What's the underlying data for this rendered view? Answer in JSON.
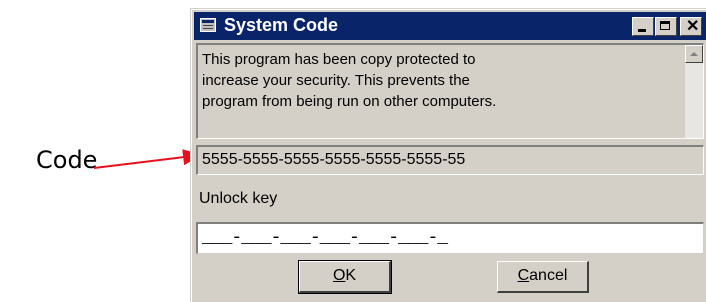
{
  "annotation": {
    "label": "Code",
    "arrow_color": "#e8101a"
  },
  "window": {
    "title": "System Code",
    "icon": "window-app-icon",
    "controls": {
      "minimize_icon": "minimize-icon",
      "maximize_icon": "maximize-icon",
      "close_glyph": "✕"
    }
  },
  "info": {
    "line1": "This program has been copy protected to",
    "line2": "increase your security. This prevents the",
    "line3": "program from being run on other computers."
  },
  "code_field": {
    "value": "5555-5555-5555-5555-5555-5555-55"
  },
  "unlock": {
    "label": "Unlock key",
    "mask": "___-___-___-___-___-___-_"
  },
  "buttons": {
    "ok_mnemonic": "O",
    "ok_rest": "K",
    "cancel_mnemonic": "C",
    "cancel_rest": "ancel"
  },
  "colors": {
    "titlebar": "#0a246a",
    "face": "#d4d0c8"
  }
}
